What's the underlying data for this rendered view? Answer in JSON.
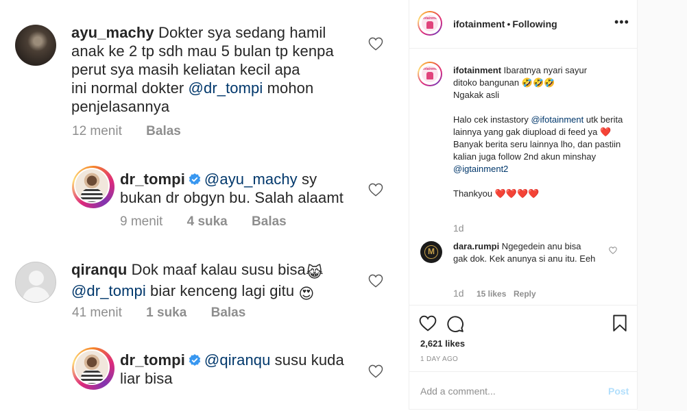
{
  "left": {
    "comments": [
      {
        "username": "ayu_machy",
        "lines": [
          "Dokter sya sedang hamil",
          "anak ke 2 tp sdh mau 5 bulan tp kenpa",
          "perut sya masih keliatan kecil apa",
          "ini normal dokter "
        ],
        "mention": "@dr_tompi",
        "after_mention": " mohon",
        "last_line": "penjelasannya",
        "time": "12 menit",
        "reply": "Balas"
      },
      {
        "username": "dr_tompi",
        "mention": "@ayu_machy",
        "line1_after": " sy",
        "line2": "bukan dr obgyn bu. Salah alaamt",
        "time": "9 menit",
        "likes": "4 suka",
        "reply": "Balas"
      },
      {
        "username": "qiranqu",
        "line1": " Dok maaf kalau susu bisa",
        "emoji1": "😹",
        "mention": "@dr_tompi",
        "line2_after": "  biar kenceng lagi gitu ",
        "emoji2": "😍",
        "time": "41 menit",
        "likes": "1 suka",
        "reply": "Balas"
      },
      {
        "username": "dr_tompi",
        "mention": "@qiranqu",
        "line1_after": " susu kuda",
        "line2": "liar bisa"
      }
    ]
  },
  "post": {
    "header": {
      "username": "ifotainment",
      "separator": "•",
      "follow_status": "Following",
      "avatar_text": "ifotainment"
    },
    "caption": {
      "username": "ifotainment",
      "line1": " Ibaratnya nyari sayur",
      "line2": "ditoko bangunan ",
      "laugh": "🤣🤣🤣",
      "line3": "Ngakak asli",
      "p2_a": "Halo cek instastory ",
      "p2_mention": "@ifotainment",
      "p2_b": " utk berita lainnya yang gak diupload di feed ya ",
      "heart": "❤️",
      "p2_c": " Banyak berita seru lainnya lho, dan pastiin kalian juga follow 2nd akun minshay",
      "p2_mention2": "@igtainment2",
      "p3": "Thankyou ",
      "hearts": "❤️❤️❤️❤️",
      "time": "1d"
    },
    "reply": {
      "username": "dara.rumpi",
      "text": " Ngegedein anu bisa gak dok. Kek anunya si anu itu. Eeh",
      "time": "1d",
      "likes": "15 likes",
      "reply_label": "Reply",
      "avatar_letter": "M"
    },
    "likes": "2,621 likes",
    "ago": "1 DAY AGO",
    "add_comment": {
      "placeholder": "Add a comment...",
      "post_label": "Post"
    }
  },
  "colors": {
    "link": "#00376b",
    "muted": "#8e8e8e",
    "heart": "#ed4956",
    "verified": "#3897f0",
    "post_disabled": "#b2dffc"
  }
}
